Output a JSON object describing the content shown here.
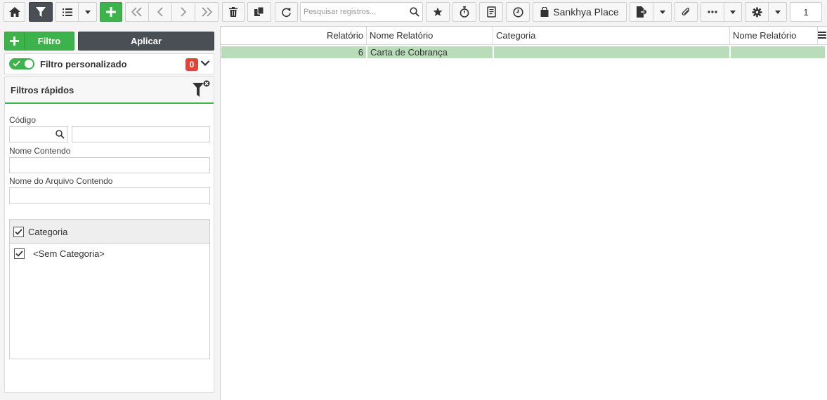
{
  "toolbar": {
    "search_placeholder": "Pesquisar registros...",
    "place_label": "Sankhya Place",
    "page_number": "1"
  },
  "filter_panel": {
    "filtro_label": "Filtro",
    "aplicar_label": "Aplicar",
    "custom_filter_label": "Filtro personalizado",
    "custom_filter_count": "0",
    "quick_filters_title": "Filtros rápidos",
    "codigo_label": "Código",
    "nome_label": "Nome Contendo",
    "arquivo_label": "Nome do Arquivo Contendo",
    "categoria_header": "Categoria",
    "categoria_items": [
      "<Sem Categoria>"
    ]
  },
  "grid": {
    "columns": [
      "Relatório",
      "Nome Relatório",
      "Categoria",
      "Nome Relatório"
    ],
    "rows": [
      {
        "relatorio": "6",
        "nome": "Carta de Cobrança",
        "categoria": "",
        "nome2": ""
      }
    ]
  },
  "colors": {
    "accent_green": "#3cb44b",
    "dark_button": "#4a4f55",
    "row_highlight": "#b9ddb9",
    "badge_red": "#e0453a"
  }
}
